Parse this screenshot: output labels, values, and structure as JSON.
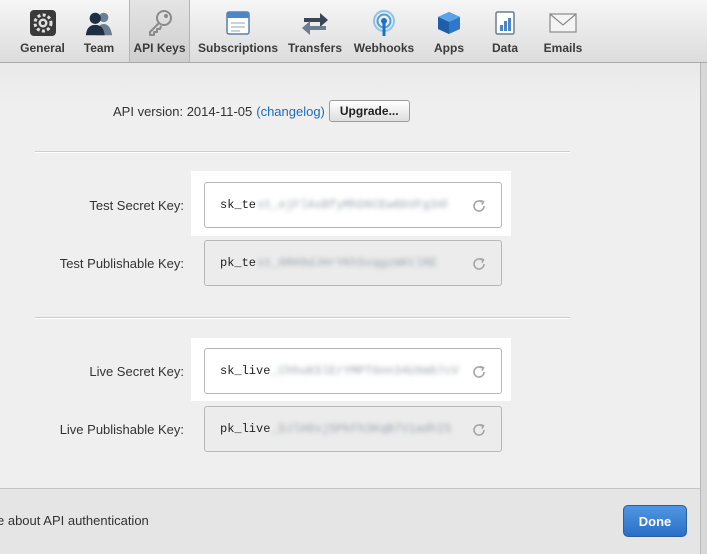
{
  "toolbar": {
    "tabs": [
      {
        "label": "General",
        "icon": "gear-icon"
      },
      {
        "label": "Team",
        "icon": "team-icon"
      },
      {
        "label": "API Keys",
        "icon": "key-icon",
        "active": true
      },
      {
        "label": "Subscriptions",
        "icon": "subscriptions-icon"
      },
      {
        "label": "Transfers",
        "icon": "transfers-icon"
      },
      {
        "label": "Webhooks",
        "icon": "webhooks-icon"
      },
      {
        "label": "Apps",
        "icon": "apps-icon"
      },
      {
        "label": "Data",
        "icon": "data-icon"
      },
      {
        "label": "Emails",
        "icon": "envelope-icon"
      }
    ]
  },
  "api": {
    "version_label": "API version: 2014-11-05",
    "changelog_link": "(changelog)",
    "upgrade_label": "Upgrade..."
  },
  "keys": [
    {
      "label": "Test Secret Key:",
      "visible": "sk_te",
      "masked": "st_ejFlAsBfyMhD6CEw6bVFg34h"
    },
    {
      "label": "Test Publishable Key:",
      "visible": "pk_te",
      "masked": "st_0RH9dJHrYKhSvqgzmKtlRE"
    },
    {
      "label": "Live Secret Key:",
      "visible": "sk_live",
      "masked": "_ChhuKSlErYMPTGnn34UXmb7cV"
    },
    {
      "label": "Live Publishable Key:",
      "visible": "pk_live",
      "masked": "_DJlH8xj5PkFh3KqB7V1adhI5"
    }
  ],
  "footer": {
    "auth_link": "e about API authentication",
    "done_label": "Done"
  },
  "colors": {
    "link": "#1a6cc8",
    "done_button": "#2a6fc6"
  }
}
